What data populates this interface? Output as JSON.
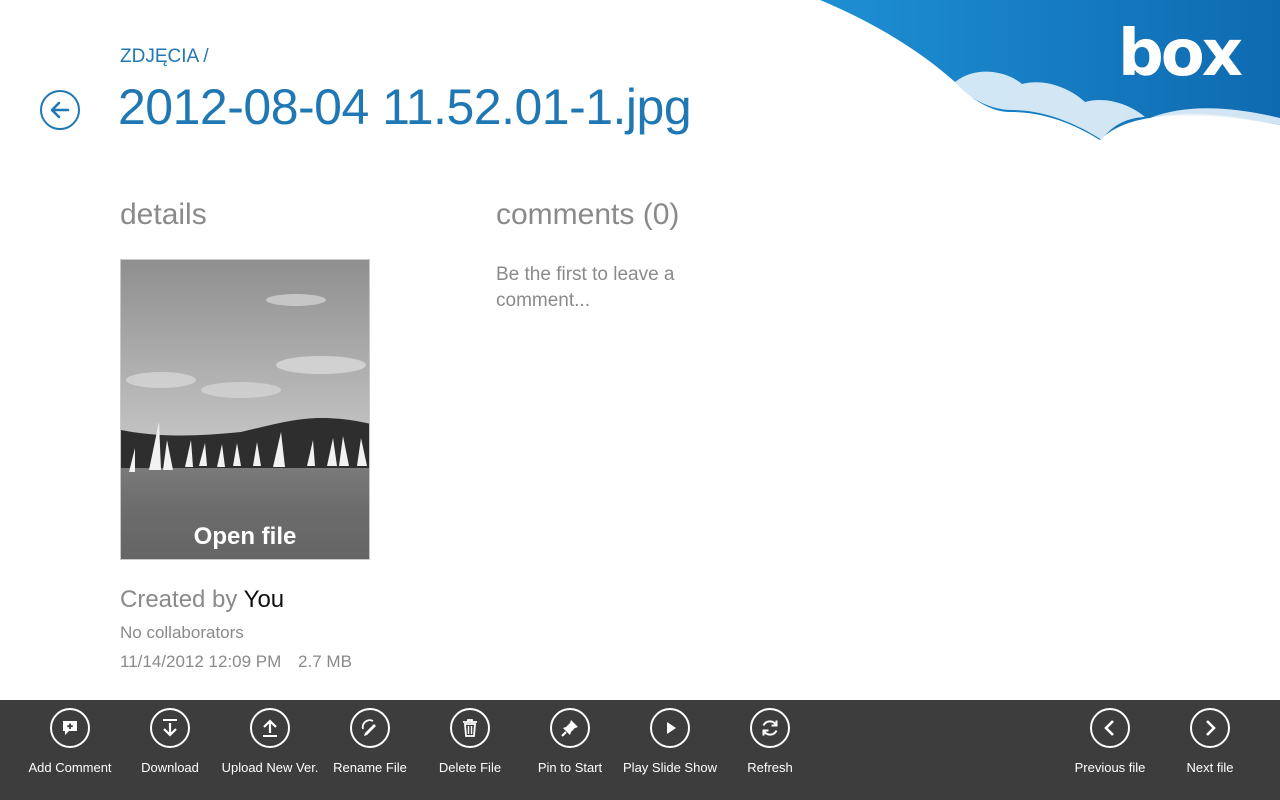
{
  "brand": {
    "logo_text": "box"
  },
  "header": {
    "breadcrumb": "ZDJĘCIA /",
    "title": "2012-08-04 11.52.01-1.jpg"
  },
  "details": {
    "heading": "details",
    "open_file_label": "Open file",
    "created_prefix": "Created by",
    "created_owner": "You",
    "collaborators": "No collaborators",
    "date": "11/14/2012 12:09 PM",
    "size": "2.7 MB"
  },
  "comments": {
    "heading": "comments (0)",
    "empty_text": "Be the first to leave a comment..."
  },
  "app_bar": {
    "left": [
      {
        "label": "Add Comment",
        "icon": "comment-plus-icon"
      },
      {
        "label": "Download",
        "icon": "download-icon"
      },
      {
        "label": "Upload New Ver.",
        "icon": "upload-icon"
      },
      {
        "label": "Rename File",
        "icon": "rename-icon"
      },
      {
        "label": "Delete File",
        "icon": "trash-icon"
      },
      {
        "label": "Pin to Start",
        "icon": "pin-icon"
      },
      {
        "label": "Play Slide Show",
        "icon": "play-icon"
      },
      {
        "label": "Refresh",
        "icon": "refresh-icon"
      }
    ],
    "right": [
      {
        "label": "Previous file",
        "icon": "chevron-left-icon"
      },
      {
        "label": "Next file",
        "icon": "chevron-right-icon"
      }
    ]
  },
  "colors": {
    "accent": "#1f78b4",
    "app_bar_bg": "#3d3d3d",
    "muted_text": "#8a8a8a",
    "brand_sky": "#1b7fc4"
  }
}
